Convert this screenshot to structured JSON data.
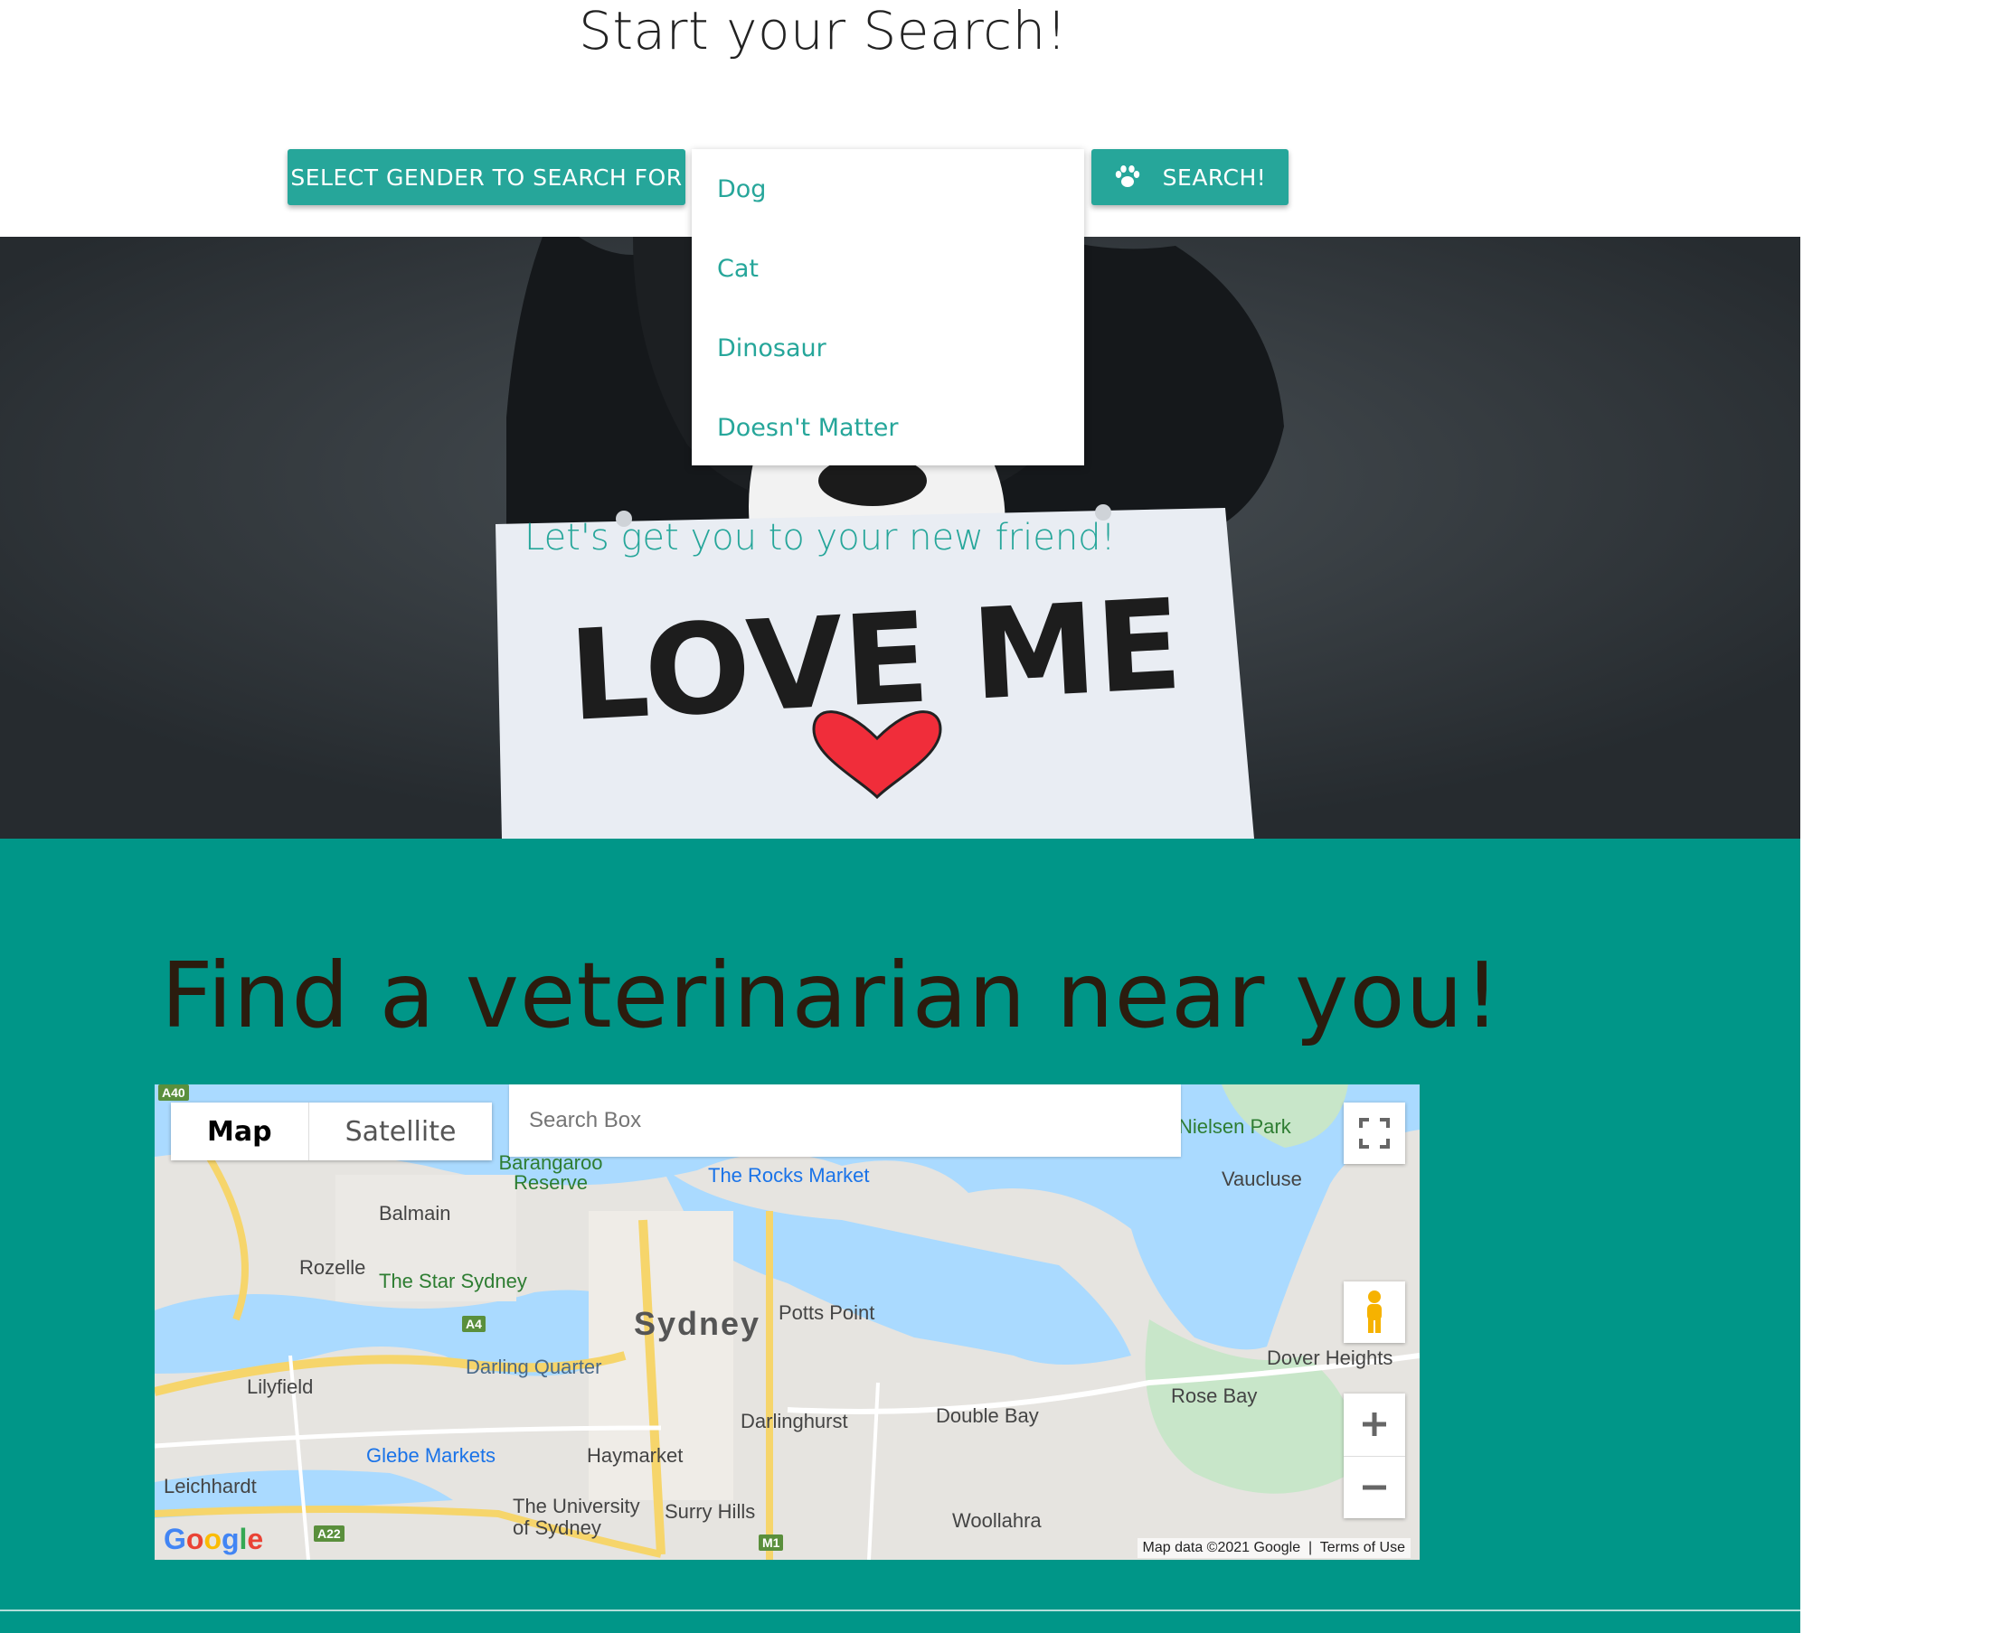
{
  "header": {
    "title": "Start your Search!"
  },
  "controls": {
    "gender_button": "SELECT GENDER TO SEARCH FOR",
    "search_button": "SEARCH!",
    "type_options": [
      "Dog",
      "Cat",
      "Dinosaur",
      "Doesn't Matter"
    ]
  },
  "hero": {
    "tagline": "Let's get you to your new friend!",
    "sign_text": "LOVE ME"
  },
  "vet": {
    "title": "Find a veterinarian near you!",
    "map": {
      "type_map": "Map",
      "type_satellite": "Satellite",
      "search_placeholder": "Search Box",
      "attribution": "Map data ©2021 Google",
      "terms": "Terms of Use",
      "logo": "Google",
      "labels": {
        "balmain": "Balmain",
        "rozelle": "Rozelle",
        "lilyfield": "Lilyfield",
        "leichhardt": "Leichhardt",
        "star": "The Star Sydney",
        "darling": "Darling Quarter",
        "glebe": "Glebe Markets",
        "haymarket": "Haymarket",
        "uni": "The University of Sydney",
        "surry": "Surry Hills",
        "sydney": "Sydney",
        "potts": "Potts Point",
        "darlinghurst": "Darlinghurst",
        "doublebay": "Double Bay",
        "woollahra": "Woollahra",
        "rosebay": "Rose Bay",
        "dover": "Dover Heights",
        "vaucluse": "Vaucluse",
        "nielsen": "Nielsen Park",
        "rocks": "The Rocks Market",
        "barangaroo": "Barangaroo Reserve"
      }
    }
  },
  "colors": {
    "accent": "#26a69a",
    "section": "#009688",
    "title_dark": "#2b1c0e"
  }
}
